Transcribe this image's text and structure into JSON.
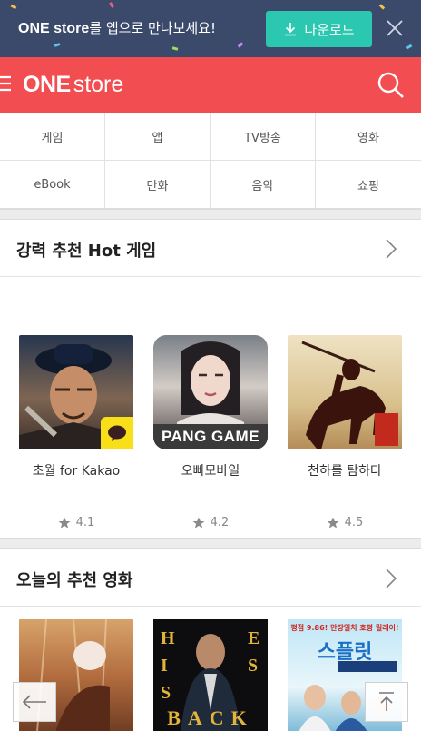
{
  "promo": {
    "brand": "ONE store",
    "message": "를 앱으로 만나보세요!",
    "download_label": "다운로드"
  },
  "header": {
    "logo_strong": "ONE",
    "logo_light": "store"
  },
  "categories": [
    "게임",
    "앱",
    "TV방송",
    "영화",
    "eBook",
    "만화",
    "음악",
    "쇼핑"
  ],
  "hot_games": {
    "title": "강력 추천 Hot 게임",
    "items": [
      {
        "name": "초월 for Kakao",
        "rating": "4.1"
      },
      {
        "name": "오빠모바일",
        "rating": "4.2",
        "badge": "PANG GAME"
      },
      {
        "name": "천하를 탐하다",
        "rating": "4.5"
      }
    ]
  },
  "movies": {
    "title": "오늘의 추천 영화",
    "posters": [
      {
        "letters": ""
      },
      {
        "letters_left": "HIS",
        "letters_right": "E S",
        "bottom": "BACK"
      },
      {
        "tagline": "평점 9.86! 만장일치 호평 릴레이!",
        "title": "스플릿"
      }
    ]
  },
  "colors": {
    "brand_red": "#f24e52",
    "promo_bg": "#3b4a6b",
    "download_bg": "#2cc7b0"
  }
}
